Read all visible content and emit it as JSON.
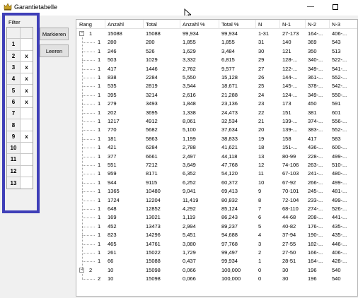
{
  "window": {
    "title": "Garantietabelle",
    "minimize_glyph": "—"
  },
  "filter": {
    "label": "Filter",
    "rows": [
      {
        "num": "1",
        "mark": ""
      },
      {
        "num": "2",
        "mark": "x"
      },
      {
        "num": "3",
        "mark": "x"
      },
      {
        "num": "4",
        "mark": "x"
      },
      {
        "num": "5",
        "mark": "x"
      },
      {
        "num": "6",
        "mark": "x"
      },
      {
        "num": "7",
        "mark": ""
      },
      {
        "num": "8",
        "mark": ""
      },
      {
        "num": "9",
        "mark": "x"
      },
      {
        "num": "10",
        "mark": ""
      },
      {
        "num": "11",
        "mark": ""
      },
      {
        "num": "12",
        "mark": ""
      },
      {
        "num": "13",
        "mark": ""
      }
    ],
    "highlight_color": "#3f3fb8"
  },
  "buttons": {
    "mark": "Markieren",
    "clear": "Leeren"
  },
  "table": {
    "columns": [
      "Rang",
      "Anzahl",
      "Total",
      "Anzahl %",
      "Total %",
      "N",
      "N-1",
      "N-2",
      "N-3"
    ],
    "rows": [
      {
        "level": 0,
        "expander": "−",
        "rang": "1",
        "anzahl": "15088",
        "total": "15088",
        "apct": "99,934",
        "tpct": "99,934",
        "n": "1-31",
        "n1": "27-173",
        "n2": "164-...",
        "n3": "406-..."
      },
      {
        "level": 1,
        "rang": "1",
        "anzahl": "280",
        "total": "280",
        "apct": "1,855",
        "tpct": "1,855",
        "n": "31",
        "n1": "140",
        "n2": "369",
        "n3": "543"
      },
      {
        "level": 1,
        "rang": "1",
        "anzahl": "246",
        "total": "526",
        "apct": "1,629",
        "tpct": "3,484",
        "n": "30",
        "n1": "121",
        "n2": "350",
        "n3": "513"
      },
      {
        "level": 1,
        "rang": "1",
        "anzahl": "503",
        "total": "1029",
        "apct": "3,332",
        "tpct": "6,815",
        "n": "29",
        "n1": "128-...",
        "n2": "340-...",
        "n3": "522-..."
      },
      {
        "level": 1,
        "rang": "1",
        "anzahl": "417",
        "total": "1446",
        "apct": "2,762",
        "tpct": "9,577",
        "n": "27",
        "n1": "122-...",
        "n2": "349-...",
        "n3": "541-..."
      },
      {
        "level": 1,
        "rang": "1",
        "anzahl": "838",
        "total": "2284",
        "apct": "5,550",
        "tpct": "15,128",
        "n": "26",
        "n1": "144-...",
        "n2": "361-...",
        "n3": "552-..."
      },
      {
        "level": 1,
        "rang": "1",
        "anzahl": "535",
        "total": "2819",
        "apct": "3,544",
        "tpct": "18,671",
        "n": "25",
        "n1": "145-...",
        "n2": "378-...",
        "n3": "542-..."
      },
      {
        "level": 1,
        "rang": "1",
        "anzahl": "395",
        "total": "3214",
        "apct": "2,616",
        "tpct": "21,288",
        "n": "24",
        "n1": "124-...",
        "n2": "349-...",
        "n3": "550-..."
      },
      {
        "level": 1,
        "rang": "1",
        "anzahl": "279",
        "total": "3493",
        "apct": "1,848",
        "tpct": "23,136",
        "n": "23",
        "n1": "173",
        "n2": "450",
        "n3": "591"
      },
      {
        "level": 1,
        "rang": "1",
        "anzahl": "202",
        "total": "3695",
        "apct": "1,338",
        "tpct": "24,473",
        "n": "22",
        "n1": "151",
        "n2": "381",
        "n3": "601"
      },
      {
        "level": 1,
        "rang": "1",
        "anzahl": "1217",
        "total": "4912",
        "apct": "8,061",
        "tpct": "32,534",
        "n": "21",
        "n1": "139-...",
        "n2": "374-...",
        "n3": "556-..."
      },
      {
        "level": 1,
        "rang": "1",
        "anzahl": "770",
        "total": "5682",
        "apct": "5,100",
        "tpct": "37,634",
        "n": "20",
        "n1": "139-...",
        "n2": "383-...",
        "n3": "552-..."
      },
      {
        "level": 1,
        "rang": "1",
        "anzahl": "181",
        "total": "5863",
        "apct": "1,199",
        "tpct": "38,833",
        "n": "19",
        "n1": "158",
        "n2": "417",
        "n3": "583"
      },
      {
        "level": 1,
        "rang": "1",
        "anzahl": "421",
        "total": "6284",
        "apct": "2,788",
        "tpct": "41,621",
        "n": "18",
        "n1": "151-...",
        "n2": "436-...",
        "n3": "600-..."
      },
      {
        "level": 1,
        "rang": "1",
        "anzahl": "377",
        "total": "6661",
        "apct": "2,497",
        "tpct": "44,118",
        "n": "13",
        "n1": "80-99",
        "n2": "228-...",
        "n3": "499-..."
      },
      {
        "level": 1,
        "rang": "1",
        "anzahl": "551",
        "total": "7212",
        "apct": "3,649",
        "tpct": "47,768",
        "n": "12",
        "n1": "74-106",
        "n2": "263-...",
        "n3": "510-..."
      },
      {
        "level": 1,
        "rang": "1",
        "anzahl": "959",
        "total": "8171",
        "apct": "6,352",
        "tpct": "54,120",
        "n": "11",
        "n1": "67-103",
        "n2": "241-...",
        "n3": "480-..."
      },
      {
        "level": 1,
        "rang": "1",
        "anzahl": "944",
        "total": "9115",
        "apct": "6,252",
        "tpct": "60,372",
        "n": "10",
        "n1": "67-92",
        "n2": "266-...",
        "n3": "499-..."
      },
      {
        "level": 1,
        "rang": "1",
        "anzahl": "1365",
        "total": "10480",
        "apct": "9,041",
        "tpct": "69,413",
        "n": "9",
        "n1": "70-101",
        "n2": "245-...",
        "n3": "481-..."
      },
      {
        "level": 1,
        "rang": "1",
        "anzahl": "1724",
        "total": "12204",
        "apct": "11,419",
        "tpct": "80,832",
        "n": "8",
        "n1": "72-104",
        "n2": "233-...",
        "n3": "499-..."
      },
      {
        "level": 1,
        "rang": "1",
        "anzahl": "648",
        "total": "12852",
        "apct": "4,292",
        "tpct": "85,124",
        "n": "7",
        "n1": "68-110",
        "n2": "274-...",
        "n3": "526-..."
      },
      {
        "level": 1,
        "rang": "1",
        "anzahl": "169",
        "total": "13021",
        "apct": "1,119",
        "tpct": "86,243",
        "n": "6",
        "n1": "44-68",
        "n2": "208-...",
        "n3": "441-..."
      },
      {
        "level": 1,
        "rang": "1",
        "anzahl": "452",
        "total": "13473",
        "apct": "2,994",
        "tpct": "89,237",
        "n": "5",
        "n1": "40-82",
        "n2": "176-...",
        "n3": "435-..."
      },
      {
        "level": 1,
        "rang": "1",
        "anzahl": "823",
        "total": "14296",
        "apct": "5,451",
        "tpct": "94,688",
        "n": "4",
        "n1": "37-94",
        "n2": "190-...",
        "n3": "435-..."
      },
      {
        "level": 1,
        "rang": "1",
        "anzahl": "465",
        "total": "14761",
        "apct": "3,080",
        "tpct": "97,768",
        "n": "3",
        "n1": "27-55",
        "n2": "182-...",
        "n3": "446-..."
      },
      {
        "level": 1,
        "rang": "1",
        "anzahl": "261",
        "total": "15022",
        "apct": "1,729",
        "tpct": "99,497",
        "n": "2",
        "n1": "27-50",
        "n2": "166-...",
        "n3": "406-..."
      },
      {
        "level": 1,
        "rang": "1",
        "anzahl": "66",
        "total": "15088",
        "apct": "0,437",
        "tpct": "99,934",
        "n": "1",
        "n1": "28-51",
        "n2": "164-...",
        "n3": "428-..."
      },
      {
        "level": 0,
        "expander": "−",
        "rang": "2",
        "anzahl": "10",
        "total": "15098",
        "apct": "0,066",
        "tpct": "100,000",
        "n": "0",
        "n1": "30",
        "n2": "196",
        "n3": "540"
      },
      {
        "level": 1,
        "rang": "2",
        "anzahl": "10",
        "total": "15098",
        "apct": "0,066",
        "tpct": "100,000",
        "n": "0",
        "n1": "30",
        "n2": "196",
        "n3": "540"
      }
    ]
  }
}
